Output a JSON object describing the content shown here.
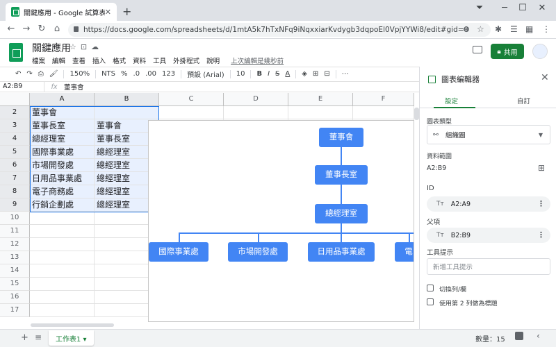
{
  "browser": {
    "tab_title": "關鍵應用 - Google 試算表",
    "url": "https://docs.google.com/spreadsheets/d/1mtA5k7hTxNFq9iNqxxiarKvdygb3dqpoEl0VpjYYWi8/edit#gid=0",
    "win_min": "─",
    "win_max": "☐",
    "win_close": "✕"
  },
  "doc": {
    "title": "關鍵應用",
    "menus": [
      "檔案",
      "編輯",
      "查看",
      "插入",
      "格式",
      "資料",
      "工具",
      "外掛程式",
      "說明"
    ],
    "last_edit": "上次編輯是幾秒前",
    "share_label": "共用"
  },
  "toolbar": {
    "zoom": "150%",
    "nts": "NTS",
    "percent": "%",
    "dec_less": ".0",
    "dec_more": ".00",
    "format_123": "123",
    "font": "預設 (Arial)",
    "font_size": "10",
    "bold": "B",
    "italic": "I",
    "strike": "S",
    "text_color": "A",
    "more": "⋯"
  },
  "formula_bar": {
    "name_box": "A2:B9",
    "fx": "fx",
    "value": "董事會"
  },
  "grid": {
    "columns": [
      "A",
      "B",
      "C",
      "D",
      "E",
      "F"
    ],
    "rows": [
      "2",
      "3",
      "4",
      "5",
      "6",
      "7",
      "8",
      "9",
      "10",
      "11",
      "12",
      "13",
      "14",
      "15",
      "16",
      "17"
    ],
    "data": [
      [
        "董事會",
        ""
      ],
      [
        "董事長室",
        "董事會"
      ],
      [
        "總經理室",
        "董事長室"
      ],
      [
        "國際事業處",
        "總經理室"
      ],
      [
        "市場開發處",
        "總經理室"
      ],
      [
        "日用品事業處",
        "總經理室"
      ],
      [
        "電子商務處",
        "總經理室"
      ],
      [
        "行銷企劃處",
        "總經理室"
      ]
    ]
  },
  "chart": {
    "nodes": [
      "董事會",
      "董事長室",
      "總經理室",
      "國際事業處",
      "市場開發處",
      "日用品事業處",
      "電"
    ],
    "color": "#4285f4"
  },
  "bottom": {
    "add": "+",
    "list": "≡",
    "sheet_name": "工作表1 ▾",
    "count": "數量：15"
  },
  "panel": {
    "title": "圖表編輯器",
    "close": "✕",
    "tab_setup": "設定",
    "tab_custom": "自訂",
    "chart_type_label": "圖表類型",
    "chart_type_value": "組織圖",
    "data_range_label": "資料範圍",
    "data_range_value": "A2:B9",
    "id_label": "ID",
    "id_range": "A2:A9",
    "parent_label": "父項",
    "parent_range": "B2:B9",
    "tooltip_label": "工具提示",
    "tooltip_placeholder": "新增工具提示",
    "switch_label": "切換列/欄",
    "header_label": "使用第 2 列做為標題",
    "chip_type": "Tт"
  }
}
